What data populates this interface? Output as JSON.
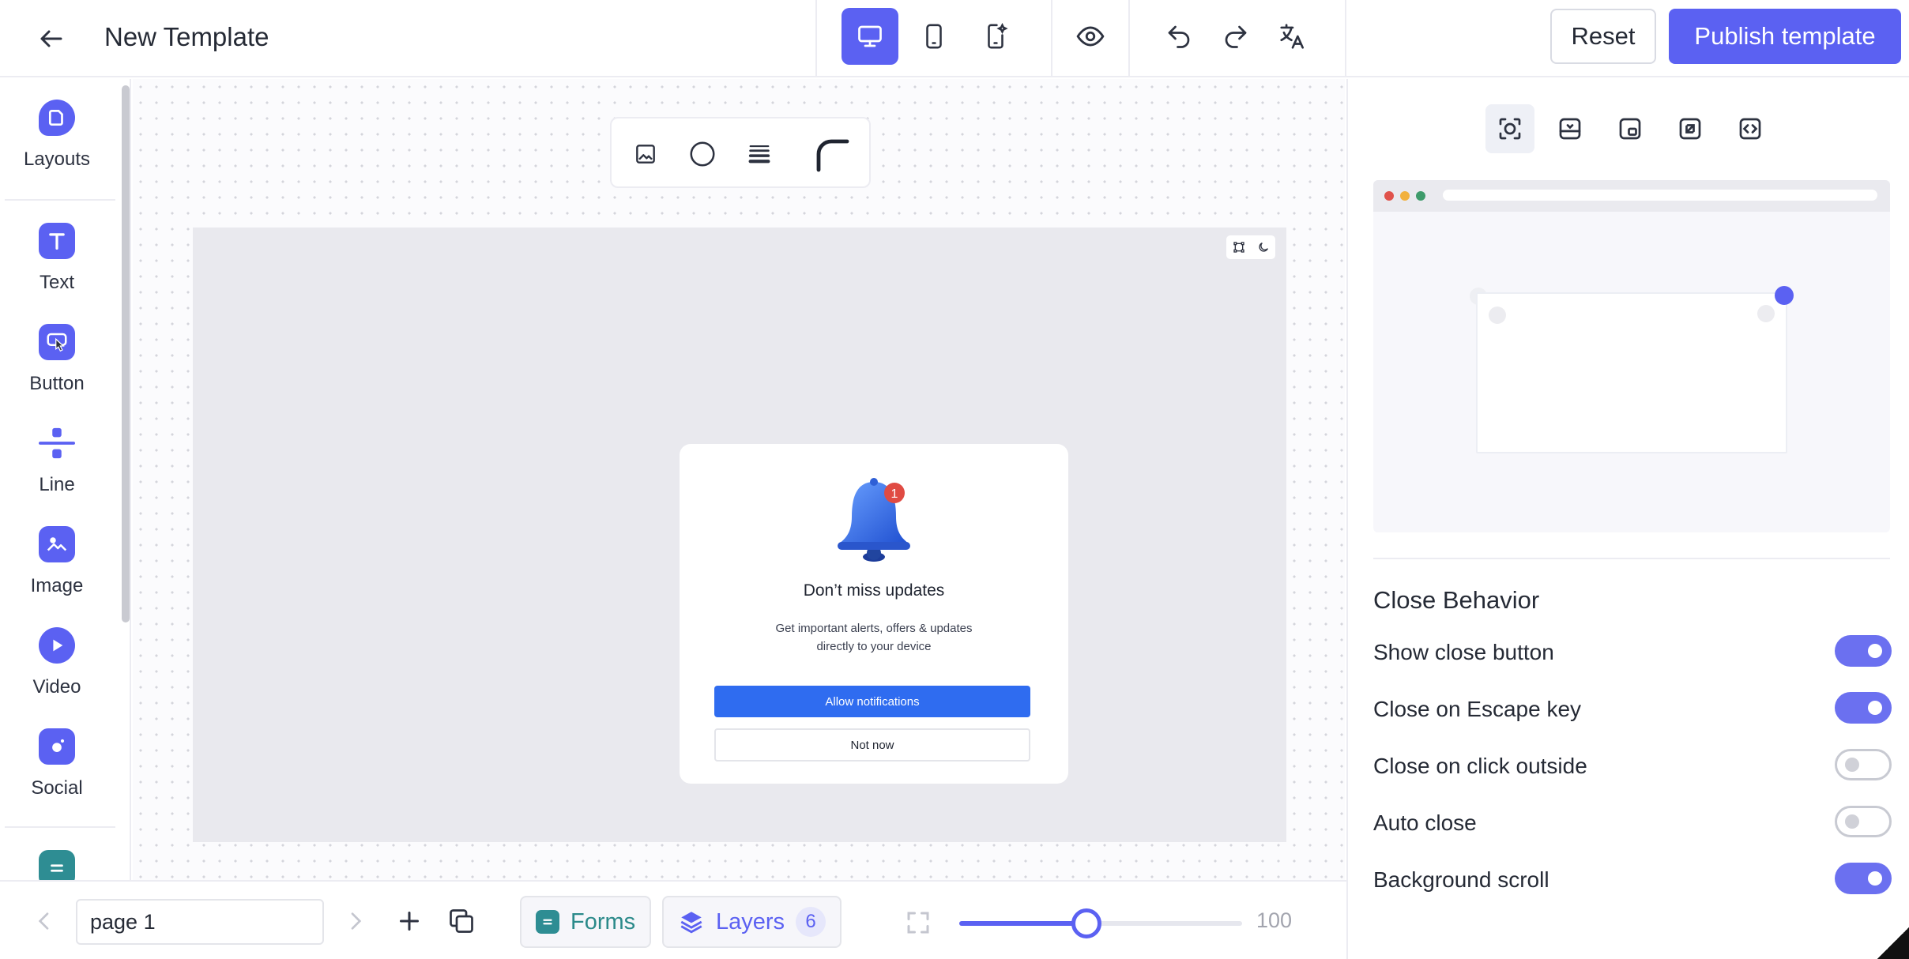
{
  "header": {
    "title": "New Template",
    "reset_label": "Reset",
    "publish_label": "Publish template",
    "icons": [
      "back-arrow-icon",
      "desktop-icon",
      "mobile-icon",
      "mobile-ai-icon",
      "eye-icon",
      "undo-icon",
      "redo-icon",
      "translate-icon"
    ]
  },
  "sidebar": {
    "items": [
      {
        "label": "Layouts",
        "icon": "layouts-icon"
      },
      {
        "label": "Text",
        "icon": "text-icon"
      },
      {
        "label": "Button",
        "icon": "pointer-icon"
      },
      {
        "label": "Line",
        "icon": "divider-icon"
      },
      {
        "label": "Image",
        "icon": "image-icon"
      },
      {
        "label": "Video",
        "icon": "play-icon"
      },
      {
        "label": "Social",
        "icon": "social-icon"
      }
    ]
  },
  "popup": {
    "badge_count": "1",
    "title": "Don’t miss updates",
    "description": "Get important alerts, offers & updates directly to your device",
    "primary_button": "Allow notifications",
    "secondary_button": "Not now"
  },
  "bottombar": {
    "page_value": "page 1",
    "forms_label": "Forms",
    "layers_label": "Layers",
    "layers_count": "6",
    "zoom_value": "100",
    "zoom_fraction": 0.45
  },
  "panel": {
    "section_title": "Close Behavior",
    "toggles": [
      {
        "label": "Show close button",
        "on": true
      },
      {
        "label": "Close on Escape key",
        "on": true
      },
      {
        "label": "Close on click outside",
        "on": false
      },
      {
        "label": "Auto close",
        "on": false
      },
      {
        "label": "Background scroll",
        "on": true
      }
    ]
  },
  "colors": {
    "accent": "#5b61f2",
    "primary_button": "#2f6cf0"
  }
}
